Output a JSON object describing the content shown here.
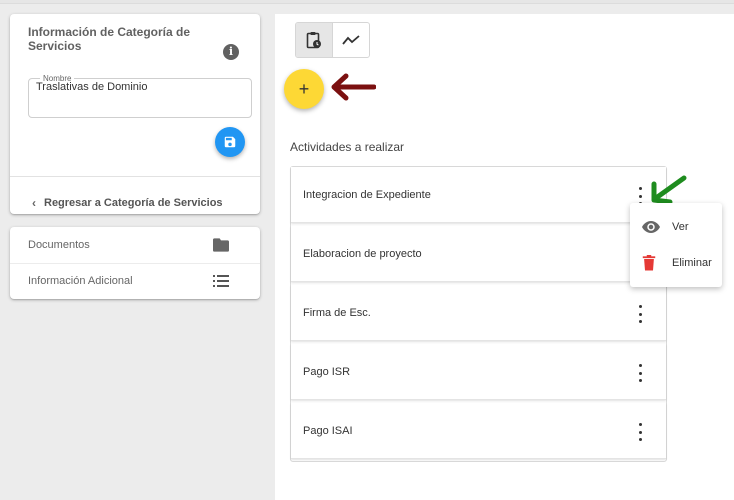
{
  "info_card": {
    "title": "Información de Categoría de Servicios",
    "info_icon": "info-icon",
    "field": {
      "label": "Nombre",
      "value": "Traslativas de Dominio"
    },
    "save_icon": "save-icon",
    "back_link": "Regresar a Categoría de Servicios"
  },
  "nav": {
    "items": [
      {
        "label": "Documentos",
        "icon": "folder-icon"
      },
      {
        "label": "Información Adicional",
        "icon": "list-icon"
      }
    ]
  },
  "toolbar": {
    "toggles": [
      {
        "icon": "clipboard-clock-icon",
        "active": true
      },
      {
        "icon": "trend-line-icon",
        "active": false
      }
    ],
    "add_label": "+"
  },
  "activities": {
    "title": "Actividades a realizar",
    "items": [
      "Integracion de Expediente",
      "Elaboracion de proyecto",
      "Firma de Esc.",
      "Pago ISR",
      "Pago ISAI"
    ]
  },
  "context_menu": {
    "items": [
      {
        "label": "Ver",
        "icon": "eye-icon",
        "color": "#666666"
      },
      {
        "label": "Eliminar",
        "icon": "trash-icon",
        "color": "#e53935"
      }
    ]
  },
  "colors": {
    "primary": "#2196f3",
    "fab": "#fdd835",
    "annotation_red": "#7b1010",
    "annotation_green": "#1e8c1e"
  }
}
